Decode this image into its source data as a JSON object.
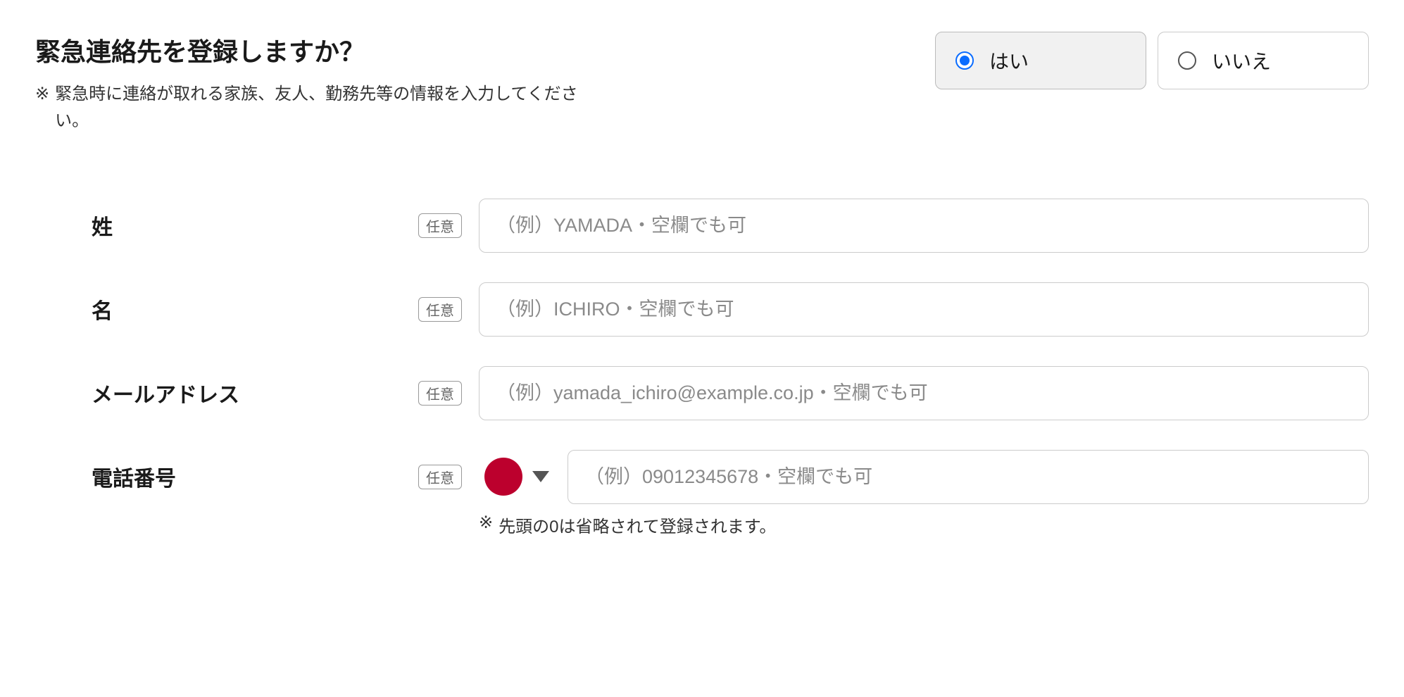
{
  "question": {
    "title": "緊急連絡先を登録しますか？",
    "note_asterisk": "※",
    "note_text": "緊急時に連絡が取れる家族、友人、勤務先等の情報を入力してください。"
  },
  "radios": {
    "yes": "はい",
    "no": "いいえ"
  },
  "fields": {
    "optional_tag": "任意",
    "surname": {
      "label": "姓",
      "placeholder": "（例）YAMADA・空欄でも可"
    },
    "given_name": {
      "label": "名",
      "placeholder": "（例）ICHIRO・空欄でも可"
    },
    "email": {
      "label": "メールアドレス",
      "placeholder": "（例）yamada_ichiro@example.co.jp・空欄でも可"
    },
    "phone": {
      "label": "電話番号",
      "placeholder": "（例）09012345678・空欄でも可",
      "note_asterisk": "※",
      "note_text": "先頭の0は省略されて登録されます。"
    }
  }
}
